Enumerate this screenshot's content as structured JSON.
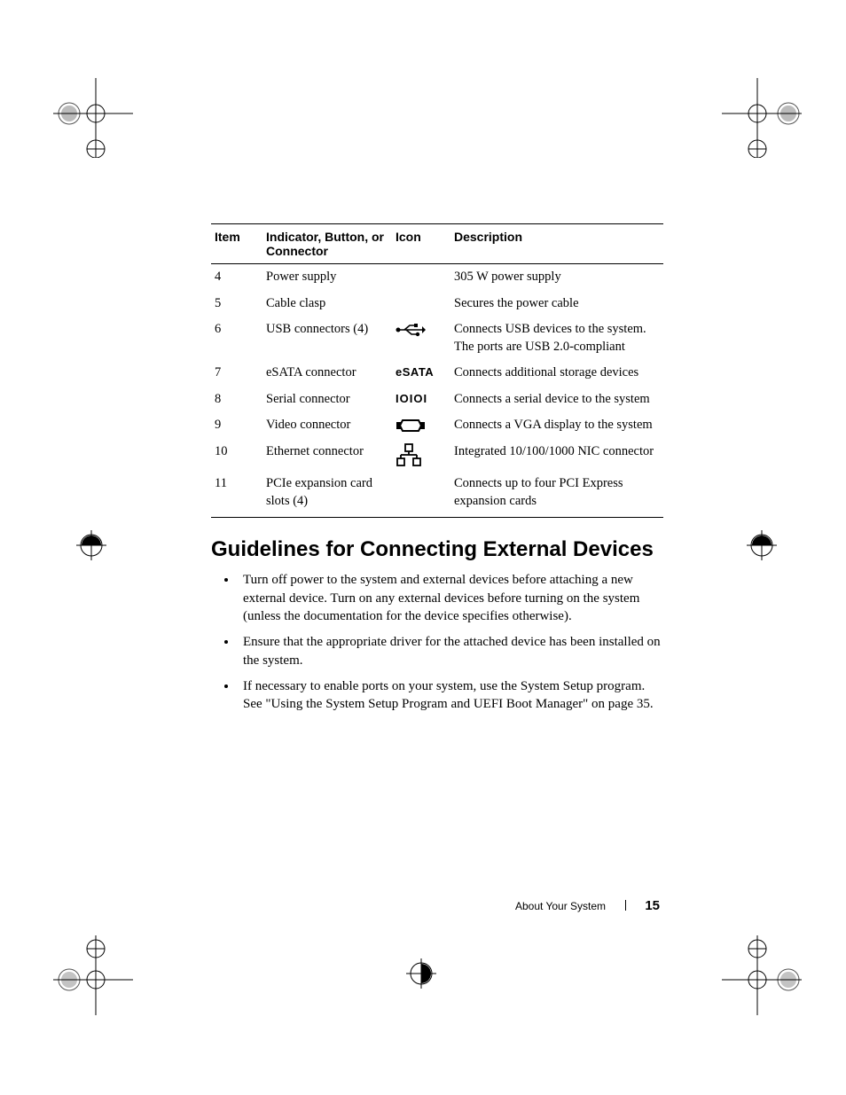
{
  "table": {
    "headers": {
      "item": "Item",
      "indicator": "Indicator, Button, or Connector",
      "icon": "Icon",
      "description": "Description"
    },
    "rows": [
      {
        "item": "4",
        "indicator": "Power supply",
        "icon": "",
        "description": "305 W power supply"
      },
      {
        "item": "5",
        "indicator": "Cable clasp",
        "icon": "",
        "description": "Secures the power cable"
      },
      {
        "item": "6",
        "indicator": "USB connectors (4)",
        "icon": "usb",
        "description": "Connects USB devices to the system. The ports are USB 2.0-compliant"
      },
      {
        "item": "7",
        "indicator": "eSATA connector",
        "icon": "eSATA",
        "description": "Connects additional storage devices"
      },
      {
        "item": "8",
        "indicator": "Serial connector",
        "icon": "IOIOI",
        "description": "Connects a serial device to the system"
      },
      {
        "item": "9",
        "indicator": "Video connector",
        "icon": "vga",
        "description": "Connects a VGA display to the system"
      },
      {
        "item": "10",
        "indicator": "Ethernet connector",
        "icon": "eth",
        "description": "Integrated 10/100/1000 NIC connector"
      },
      {
        "item": "11",
        "indicator": "PCIe expansion card slots (4)",
        "icon": "",
        "description": "Connects up to four PCI Express expansion cards"
      }
    ]
  },
  "section": {
    "title": "Guidelines for Connecting External Devices",
    "bullets": [
      "Turn off power to the system and external devices before attaching a new external device. Turn on any external devices before turning on the system (unless the documentation for the device specifies otherwise).",
      "Ensure that the appropriate driver for the attached device has been installed on the system.",
      "If necessary to enable ports on your system, use the System Setup program. See \"Using the System Setup Program and UEFI Boot Manager\" on page 35."
    ]
  },
  "footer": {
    "section_name": "About Your System",
    "page_number": "15"
  }
}
